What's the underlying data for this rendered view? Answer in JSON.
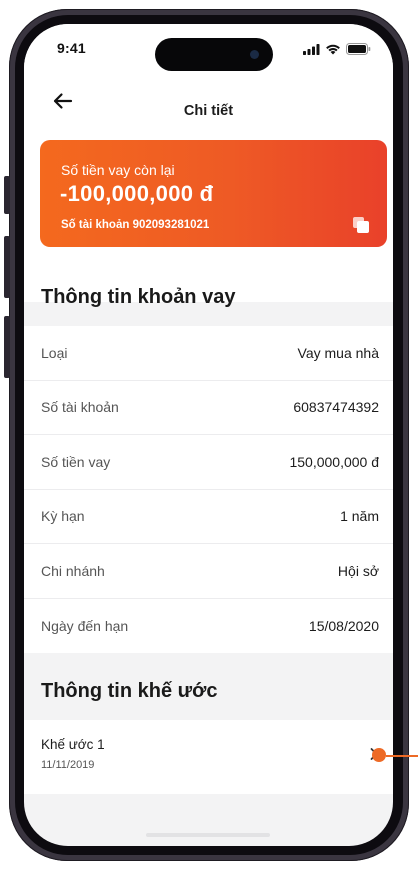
{
  "status_bar": {
    "time": "9:41"
  },
  "header": {
    "title": "Chi tiết"
  },
  "loan_card": {
    "label": "Số tiền vay còn lại",
    "amount": "-100,000,000 đ",
    "account": "Số tài khoản 902093281021"
  },
  "loan_info": {
    "title": "Thông tin khoản vay",
    "rows": [
      {
        "key": "Loại",
        "value": "Vay mua nhà"
      },
      {
        "key": "Số tài khoản",
        "value": "60837474392"
      },
      {
        "key": "Số tiền vay",
        "value": "150,000,000 đ"
      },
      {
        "key": "Kỳ hạn",
        "value": "1 năm"
      },
      {
        "key": "Chi nhánh",
        "value": "Hội sở"
      },
      {
        "key": "Ngày đến hạn",
        "value": "15/08/2020"
      }
    ]
  },
  "contracts": {
    "title": "Thông tin khế ước",
    "items": [
      {
        "name": "Khế ước 1",
        "date": "11/11/2019"
      }
    ]
  },
  "colors": {
    "accent": "#ee5a25",
    "accent_dark": "#e9412a",
    "annotation": "#ed6a26"
  },
  "icons": [
    "back-arrow-icon",
    "copy-icon",
    "chevron-right-icon",
    "signal-icon",
    "wifi-icon",
    "battery-icon"
  ]
}
